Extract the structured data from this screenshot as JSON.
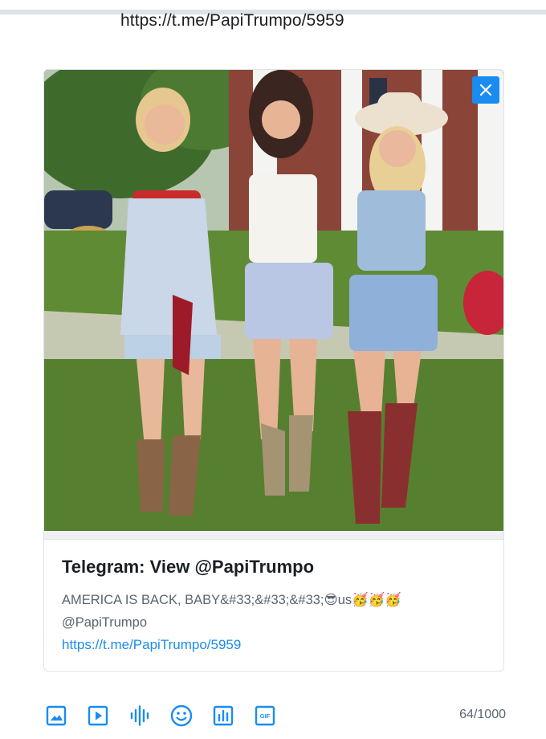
{
  "header": {
    "url": "https://t.me/PapiTrumpo/5959"
  },
  "preview": {
    "image_alt": "Three young women in cowboy boots and denim shorts walking arm in arm on a lawn",
    "title": "Telegram: View @PapiTrumpo",
    "description": "AMERICA IS BACK, BABY&#33;&#33;&#33;😎us🥳🥳🥳",
    "handle": "@PapiTrumpo",
    "link": "https://t.me/PapiTrumpo/5959",
    "close_icon": "close-icon"
  },
  "toolbar": {
    "tools": [
      "image-icon",
      "video-icon",
      "audio-icon",
      "emoji-icon",
      "poll-icon",
      "gif-icon"
    ],
    "gif_label": "GIF"
  },
  "counter": "64/1000",
  "colors": {
    "accent": "#1a8cf0",
    "muted_text": "#5b6470",
    "border": "#dde2e8"
  }
}
